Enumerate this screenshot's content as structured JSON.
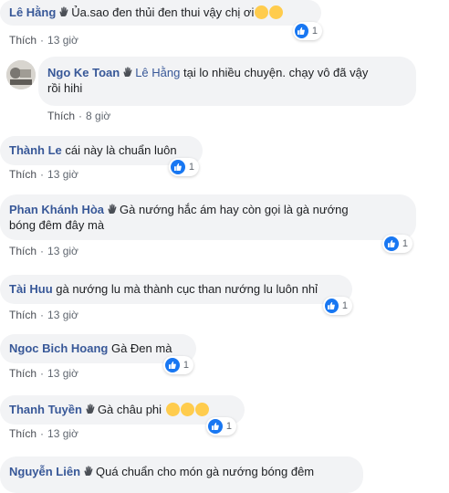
{
  "like_label": "Thích",
  "comments": [
    {
      "name": "Lê Hằng",
      "text": "Ủa.sao đen thủi đen thui vậy chị ơi",
      "time": "13 giờ",
      "reactions": "1"
    },
    {
      "name": "Ngo Ke Toan",
      "tag": "Lê Hằng",
      "text_line1": "tại lo nhiều chuyện. chạy vô đã vậy",
      "text_line2": "rồi hihi",
      "time": "8 giờ"
    },
    {
      "name": "Thành Le",
      "text": "cái này là chuẩn luôn",
      "time": "13 giờ",
      "reactions": "1"
    },
    {
      "name": "Phan Khánh Hòa",
      "text_line1": "Gà nướng hắc ám hay còn gọi là gà nướng",
      "text_line2": "bóng đêm đây mà",
      "time": "13 giờ",
      "reactions": "1"
    },
    {
      "name": "Tài Huu",
      "text": "gà nướng lu mà thành cục than nướng lu luôn nhỉ",
      "time": "13 giờ",
      "reactions": "1"
    },
    {
      "name": "Ngoc Bich Hoang",
      "text": "Gà Đen mà",
      "time": "13 giờ",
      "reactions": "1"
    },
    {
      "name": "Thanh Tuyền",
      "text": "Gà châu phi",
      "time": "13 giờ",
      "reactions": "1"
    },
    {
      "name": "Nguyễn Liên",
      "text": "Quá chuẩn cho món gà nướng bóng đêm"
    }
  ],
  "colors": {
    "name": "#385898",
    "bubble": "#f2f3f5",
    "meta": "#606770",
    "like_blue": "#1877f2"
  }
}
